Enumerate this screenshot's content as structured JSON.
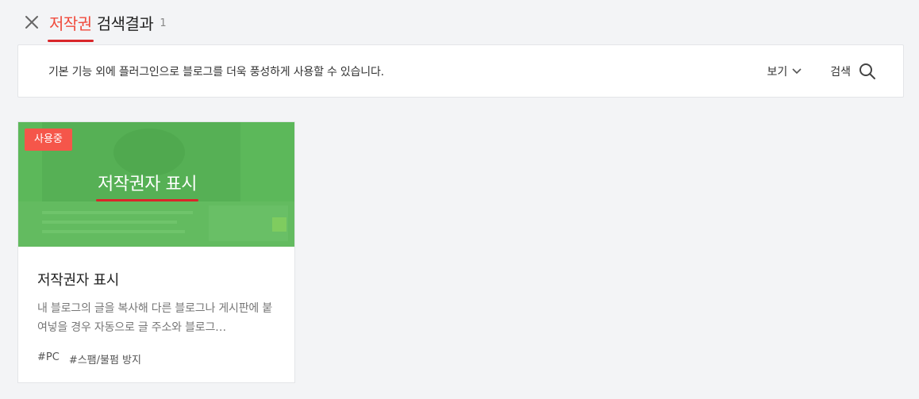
{
  "header": {
    "keyword": "저작권",
    "title_rest": "검색결과",
    "count": "1"
  },
  "toolbar": {
    "description": "기본 기능 외에 플러그인으로 블로그를 더욱 풍성하게 사용할 수 있습니다.",
    "view_label": "보기",
    "search_label": "검색"
  },
  "results": [
    {
      "badge": "사용중",
      "thumb_title": "저작권자 표시",
      "title": "저작권자 표시",
      "description": "내 블로그의 글을 복사해 다른 블로그나 게시판에 붙여넣을 경우 자동으로 글 주소와 블로그…",
      "tags": [
        "#PC",
        "#스팸/불펌 방지"
      ]
    }
  ],
  "colors": {
    "accent": "#f04a3c",
    "badge": "#f5564a",
    "underline": "#d9262a",
    "thumb_green": "#5cb85a"
  }
}
